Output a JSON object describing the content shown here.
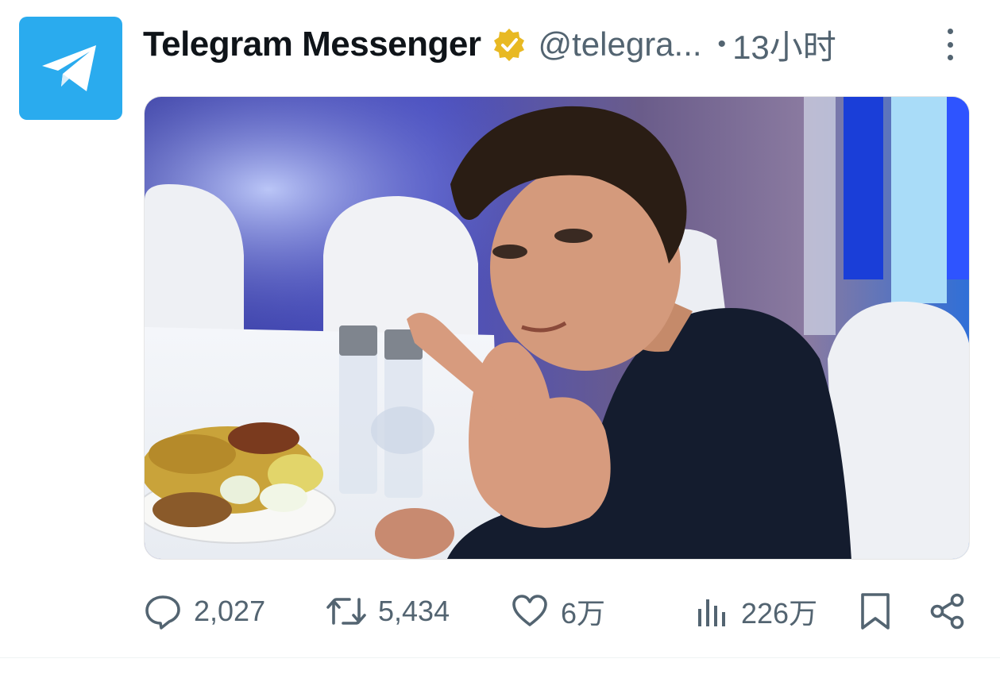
{
  "tweet": {
    "author": {
      "display_name": "Telegram Messenger",
      "handle": "@telegra...",
      "verified": true,
      "avatar_icon": "telegram-logo-icon",
      "avatar_color": "#2aabee",
      "verified_color": "#e8b923"
    },
    "separator": "•",
    "time": "13小时",
    "media": {
      "type": "photo"
    },
    "actions": {
      "replies": {
        "icon": "reply-icon",
        "count": "2,027"
      },
      "retweets": {
        "icon": "retweet-icon",
        "count": "5,434"
      },
      "likes": {
        "icon": "heart-icon",
        "count": "6万"
      },
      "views": {
        "icon": "views-icon",
        "count": "226万"
      },
      "bookmark": {
        "icon": "bookmark-icon"
      },
      "share": {
        "icon": "share-icon"
      }
    },
    "colors": {
      "text_primary": "#0f1419",
      "text_secondary": "#536471"
    }
  }
}
